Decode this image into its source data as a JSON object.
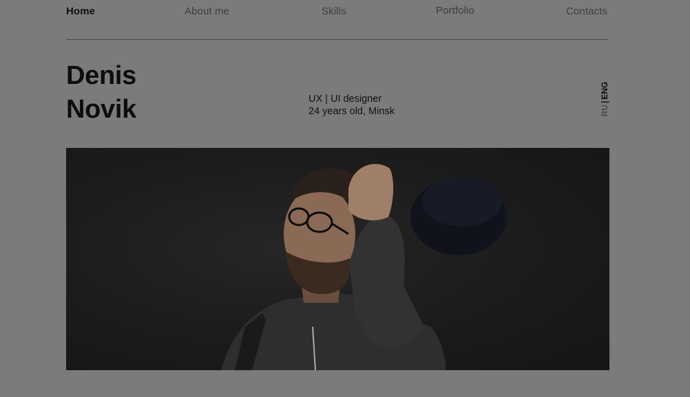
{
  "nav": {
    "items": [
      {
        "label": "Home",
        "active": true
      },
      {
        "label": "About me"
      },
      {
        "label": "Skills"
      },
      {
        "label": "Portfolio"
      },
      {
        "label": "Contacts"
      }
    ]
  },
  "hero": {
    "first_name": "Denis",
    "last_name": "Novik",
    "role": "UX | UI designer",
    "details": "24 years old, Minsk"
  },
  "language": {
    "ru": "RU",
    "separator": "|",
    "eng": "ENG",
    "active": "ENG"
  },
  "photo": {
    "subject": "portrait-photo"
  }
}
